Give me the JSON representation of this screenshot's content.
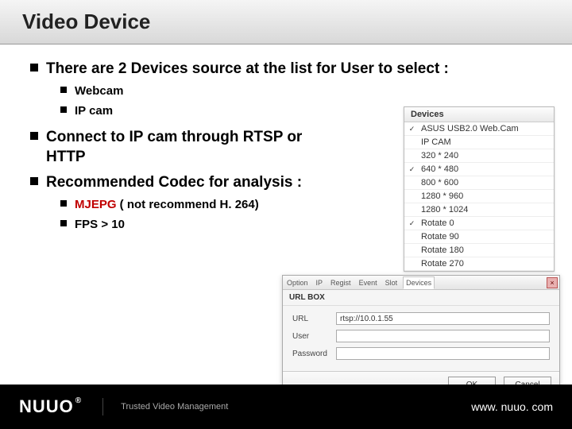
{
  "title": "Video Device",
  "bullets": {
    "b1": "There are 2 Devices source at the list for User to select :",
    "b1_items": {
      "i0": "Webcam",
      "i1": "IP cam"
    },
    "b2": "Connect to IP cam through RTSP or HTTP",
    "b3": "Recommended Codec for analysis :",
    "b3_items": {
      "i0_red": "MJEPG",
      "i0_rest": " ( not recommend H. 264)",
      "i1": "FPS > 10"
    }
  },
  "devices_panel": {
    "header": "Devices",
    "rows": [
      {
        "checked": true,
        "label": "ASUS USB2.0 Web.Cam"
      },
      {
        "checked": false,
        "label": "IP CAM"
      },
      {
        "checked": false,
        "label": "320 * 240"
      },
      {
        "checked": true,
        "label": "640 * 480"
      },
      {
        "checked": false,
        "label": "800 * 600"
      },
      {
        "checked": false,
        "label": "1280 * 960"
      },
      {
        "checked": false,
        "label": "1280 * 1024"
      },
      {
        "checked": true,
        "label": "Rotate 0"
      },
      {
        "checked": false,
        "label": "Rotate 90"
      },
      {
        "checked": false,
        "label": "Rotate 180"
      },
      {
        "checked": false,
        "label": "Rotate 270"
      }
    ]
  },
  "urlbox": {
    "tabs": [
      "Option",
      "IP",
      "Regist",
      "Event",
      "Slot",
      "Devices"
    ],
    "close": "×",
    "title": "URL BOX",
    "fields": {
      "url_label": "URL",
      "url_value": "rtsp://10.0.1.55",
      "user_label": "User",
      "user_value": "",
      "pw_label": "Password",
      "pw_value": ""
    },
    "buttons": {
      "ok": "OK",
      "cancel": "Cancel"
    }
  },
  "footer": {
    "logo": "NUUO",
    "reg": "®",
    "tagline": "Trusted Video Management",
    "url": "www. nuuo. com"
  }
}
